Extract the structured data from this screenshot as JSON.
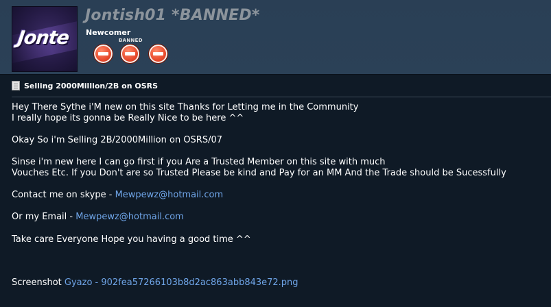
{
  "header": {
    "username": "Jontish01 *BANNED*",
    "user_title": "Newcomer",
    "banned_tag": "BANNED",
    "avatar_text": "Jonte",
    "badges": [
      "banned-icon",
      "banned-icon",
      "banned-icon"
    ]
  },
  "post": {
    "title": "Selling 2000Million/2B on OSRS",
    "lines": [
      "Hey There Sythe i'M new on this site Thanks for Letting me in the Community",
      "I really hope its gonna be Really Nice to be here ^^",
      "Okay So i'm Selling 2B/2000Million on OSRS/07",
      "Sinse i'm new here I can go first if you Are a Trusted Member on this site with much",
      "Vouches Etc. If you Don't are so Trusted Please be kind and Pay for an MM And the Trade should be Sucessfully",
      "Take care Everyone Hope you having a good time ^^"
    ],
    "skype_label": "Contact me on skype - ",
    "skype_link": "Mewpewz@hotmail.com",
    "email_label": "Or my Email - ",
    "email_link": "Mewpewz@hotmail.com",
    "screenshot_label": "Screenshot ",
    "screenshot_link": "Gyazo - 902fea57266103b8d2ac863abb843e72.png"
  },
  "colors": {
    "header_bg": "#2b4157",
    "body_bg": "#0f1a26",
    "link": "#6fa5e8",
    "username": "#8c949c",
    "badge_red": "#e84a2c"
  }
}
